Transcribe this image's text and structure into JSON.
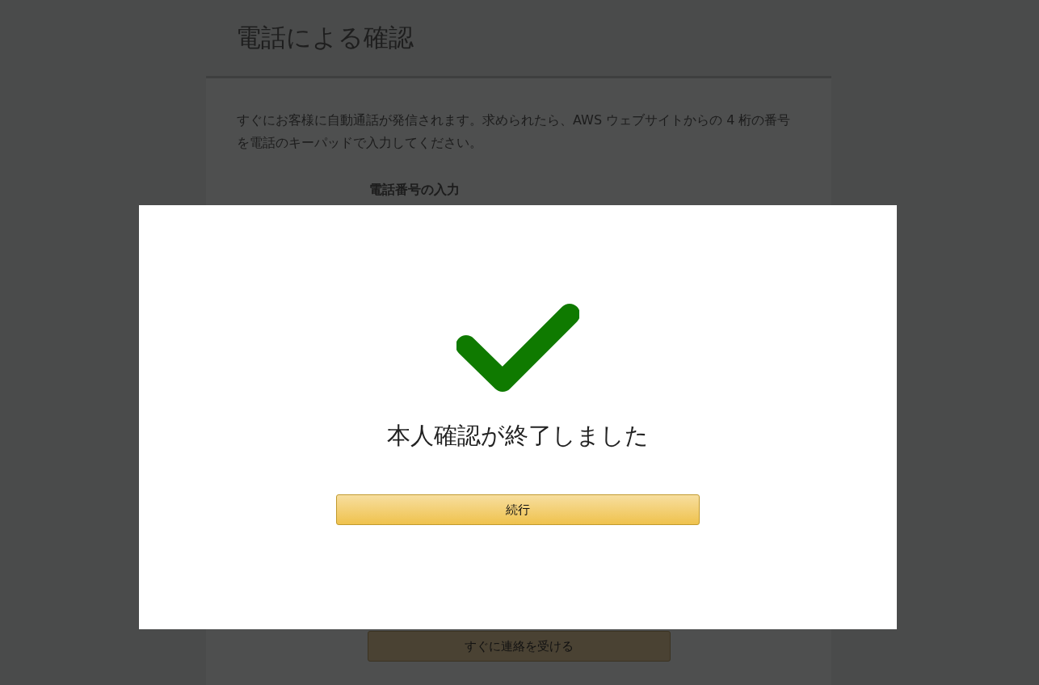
{
  "page": {
    "title": "電話による確認",
    "instructions": "すぐにお客様に自動通話が発信されます。求められたら、AWS ウェブサイトからの 4 桁の番号を電話のキーパッドで入力してください。",
    "phone_label": "電話番号の入力",
    "call_button": "すぐに連絡を受ける"
  },
  "modal": {
    "message": "本人確認が終了しました",
    "button": "続行"
  }
}
